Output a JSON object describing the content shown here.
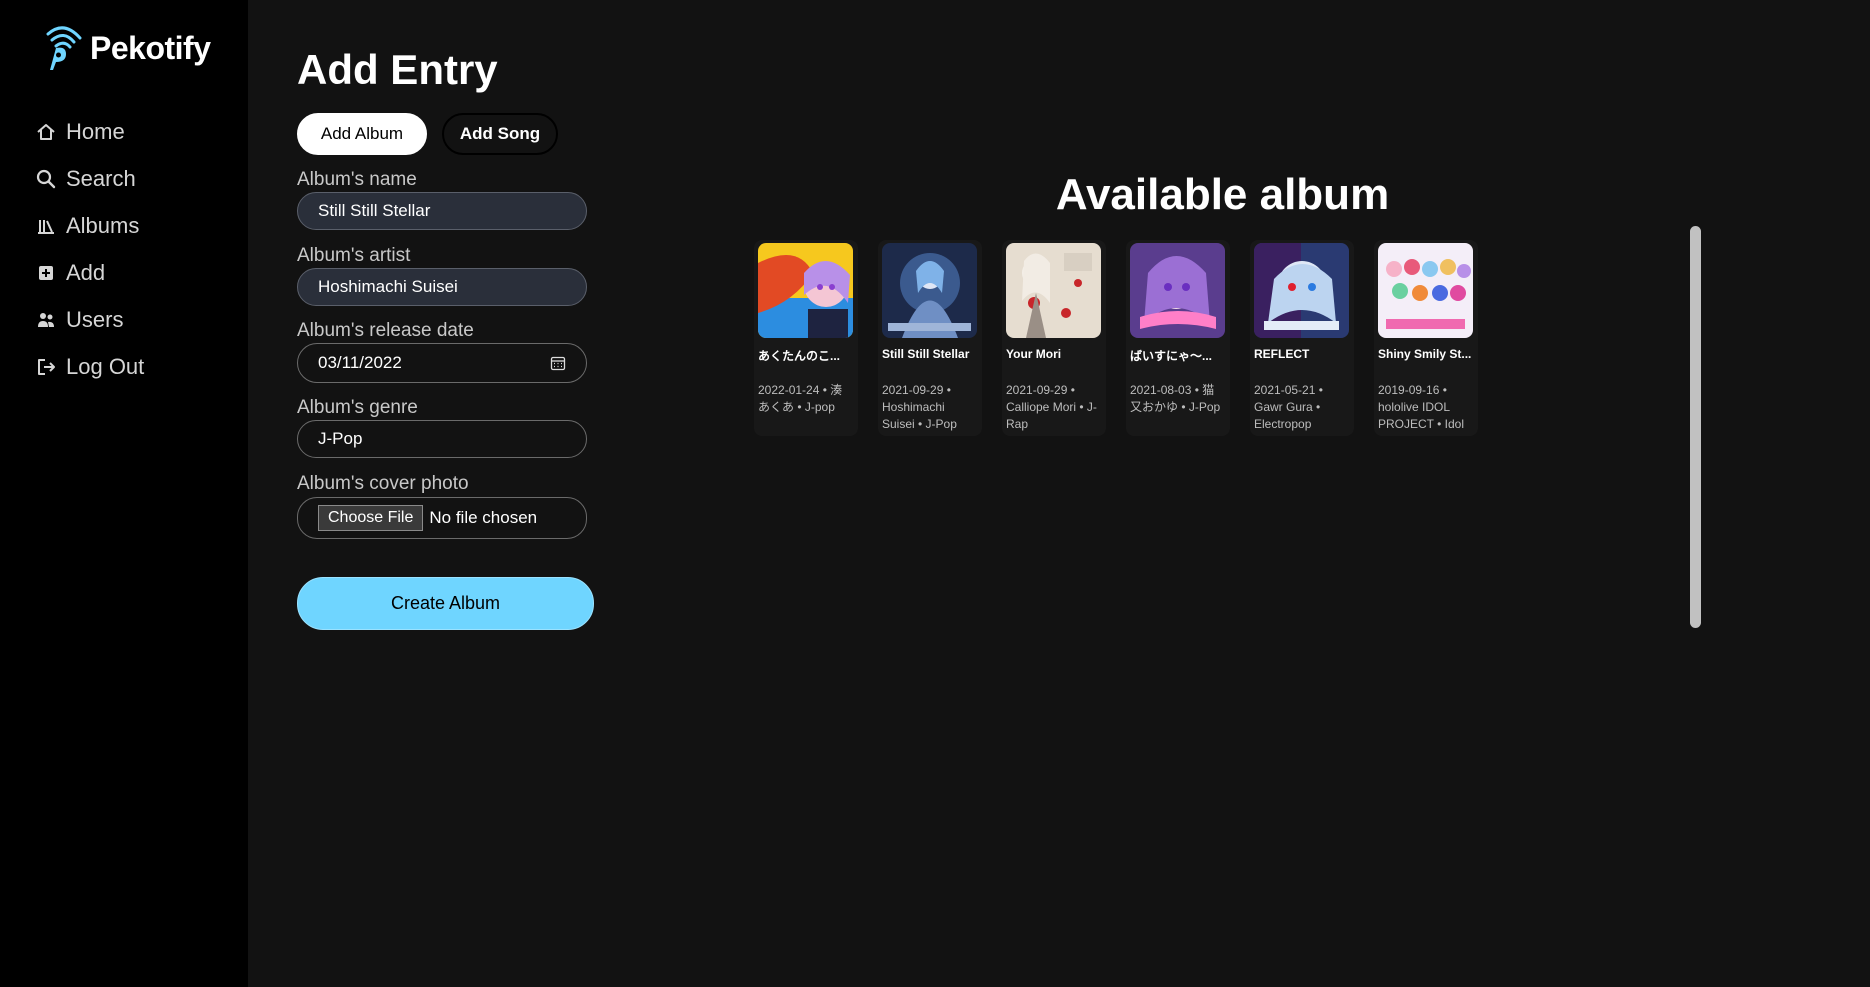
{
  "app": {
    "name": "Pekotify",
    "brand_color": "#6fd5ff"
  },
  "sidebar": {
    "items": [
      {
        "label": "Home",
        "icon": "home-icon"
      },
      {
        "label": "Search",
        "icon": "search-icon"
      },
      {
        "label": "Albums",
        "icon": "albums-icon"
      },
      {
        "label": "Add",
        "icon": "add-icon"
      },
      {
        "label": "Users",
        "icon": "users-icon"
      },
      {
        "label": "Log Out",
        "icon": "logout-icon"
      }
    ]
  },
  "main": {
    "title": "Add Entry",
    "tabs": {
      "album": "Add Album",
      "song": "Add Song"
    },
    "form": {
      "name_label": "Album's name",
      "name_value": "Still Still Stellar",
      "artist_label": "Album's artist",
      "artist_value": "Hoshimachi Suisei",
      "date_label": "Album's release date",
      "date_value": "03/11/2022",
      "genre_label": "Album's genre",
      "genre_value": "J-Pop",
      "cover_label": "Album's cover photo",
      "choose_file": "Choose File",
      "no_file": "No file chosen",
      "submit": "Create Album"
    }
  },
  "available": {
    "title": "Available album",
    "albums": [
      {
        "name": "あくたんのこ...",
        "meta": "2022-01-24 • 湊あくあ • J-pop"
      },
      {
        "name": "Still Still Stellar",
        "meta": "2021-09-29 • Hoshimachi Suisei • J-Pop"
      },
      {
        "name": "Your Mori",
        "meta": "2021-09-29 • Calliope Mori • J-Rap"
      },
      {
        "name": "ばいすにゃ〜...",
        "meta": "2021-08-03 • 猫又おかゆ • J-Pop"
      },
      {
        "name": "REFLECT",
        "meta": "2021-05-21 • Gawr Gura • Electropop"
      },
      {
        "name": "Shiny Smily St...",
        "meta": "2019-09-16 • hololive IDOL PROJECT • Idol"
      }
    ]
  }
}
